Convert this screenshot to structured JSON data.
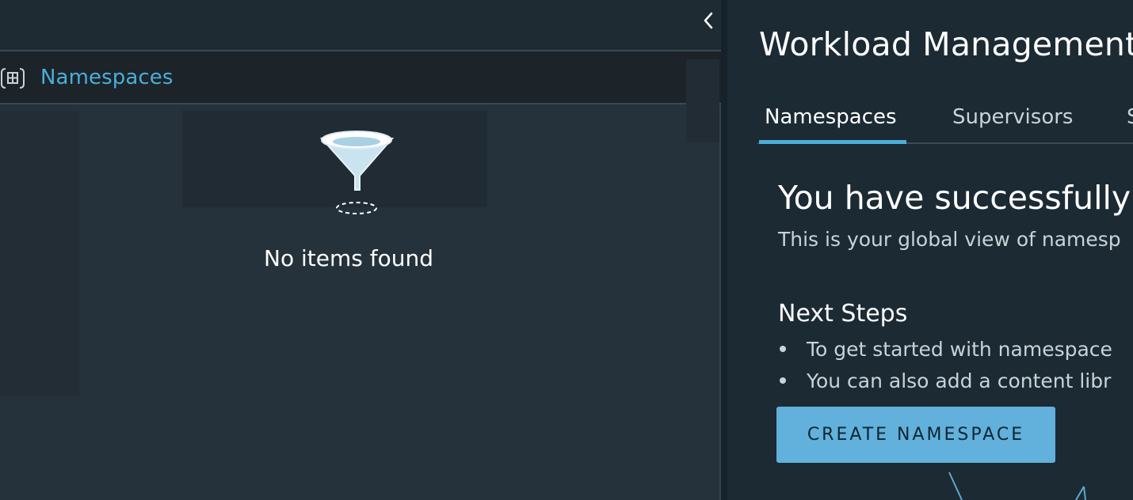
{
  "nav": {
    "collapse_icon": "chevron-left-icon",
    "namespaces_icon": "namespace-icon",
    "namespaces_label": "Namespaces",
    "empty_state_icon": "funnel-icon",
    "empty_state_text": "No items found"
  },
  "header": {
    "title": "Workload Management"
  },
  "tabs": [
    {
      "label": "Namespaces",
      "selected": true
    },
    {
      "label": "Supervisors",
      "selected": false
    },
    {
      "label": "S",
      "selected": false
    }
  ],
  "main": {
    "success_title": "You have successfully",
    "success_subtitle": "This is your global view of namesp",
    "next_steps_title": "Next Steps",
    "steps": [
      "To get started with namespace",
      "You can also add a content libr"
    ],
    "create_button_label": "CREATE NAMESPACE"
  },
  "colors": {
    "accent": "#49afd9",
    "button": "#61b1dc",
    "background": "#1c2a33"
  }
}
